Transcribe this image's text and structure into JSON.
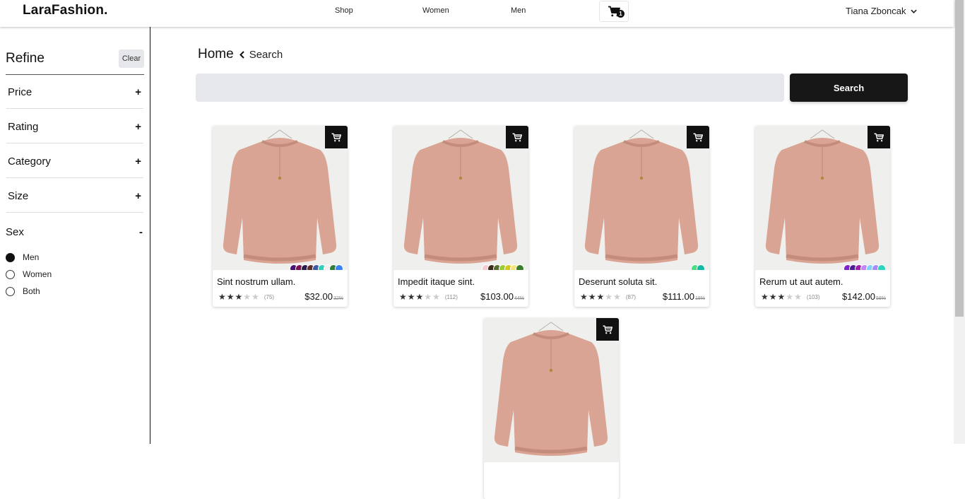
{
  "header": {
    "logo": "LaraFashion.",
    "nav": [
      {
        "label": "Shop"
      },
      {
        "label": "Women"
      },
      {
        "label": "Men"
      }
    ],
    "cart_count": "1",
    "user_name": "Tiana Zboncak"
  },
  "sidebar": {
    "title": "Refine",
    "clear_label": "Clear",
    "filters": [
      {
        "label": "Price",
        "toggle": "+"
      },
      {
        "label": "Rating",
        "toggle": "+"
      },
      {
        "label": "Category",
        "toggle": "+"
      },
      {
        "label": "Size",
        "toggle": "+"
      }
    ],
    "sex": {
      "label": "Sex",
      "toggle": "-",
      "options": [
        {
          "label": "Men",
          "selected": true
        },
        {
          "label": "Women",
          "selected": false
        },
        {
          "label": "Both",
          "selected": false
        }
      ]
    }
  },
  "main": {
    "breadcrumb": {
      "home": "Home",
      "current": "Search"
    },
    "search": {
      "value": "",
      "placeholder": "",
      "button_label": "Search"
    },
    "products": [
      {
        "name": "Sint nostrum ullam.",
        "rating": 3,
        "reviews": "(75)",
        "price": "$32.00",
        "discount": "32%",
        "colors": [
          "#4b0f7a",
          "#7a1050",
          "#2d1b4e",
          "#5a2e2e",
          "#3b5ba5",
          "#2ed0b8",
          "#f0f0f0",
          "#2e7d3a",
          "#3b82f6"
        ]
      },
      {
        "name": "Impedit itaque sint.",
        "rating": 3,
        "reviews": "(112)",
        "price": "$103.00",
        "discount": "44%",
        "colors": [
          "#f7c9d0",
          "#3b2a1a",
          "#556b2f",
          "#9acd32",
          "#d4c91a",
          "#f5e27a",
          "#3a7d2a"
        ]
      },
      {
        "name": "Deserunt soluta sit.",
        "rating": 3,
        "reviews": "(87)",
        "price": "$111.00",
        "discount": "18%",
        "colors": [
          "#4ade80",
          "#14b8a6"
        ]
      },
      {
        "name": "Rerum ut aut autem.",
        "rating": 3,
        "reviews": "(103)",
        "price": "$142.00",
        "discount": "58%",
        "colors": [
          "#7e22ce",
          "#4c1d95",
          "#a21caf",
          "#c084fc",
          "#7dd3fc",
          "#a78bfa",
          "#2dd4bf"
        ]
      },
      {
        "name": "",
        "rating": 0,
        "reviews": "",
        "price": "",
        "discount": "",
        "colors": []
      }
    ]
  },
  "colors": {
    "accent_dark": "#171717",
    "input_bg": "#e5e7eb",
    "sweater": "#d9a493"
  }
}
